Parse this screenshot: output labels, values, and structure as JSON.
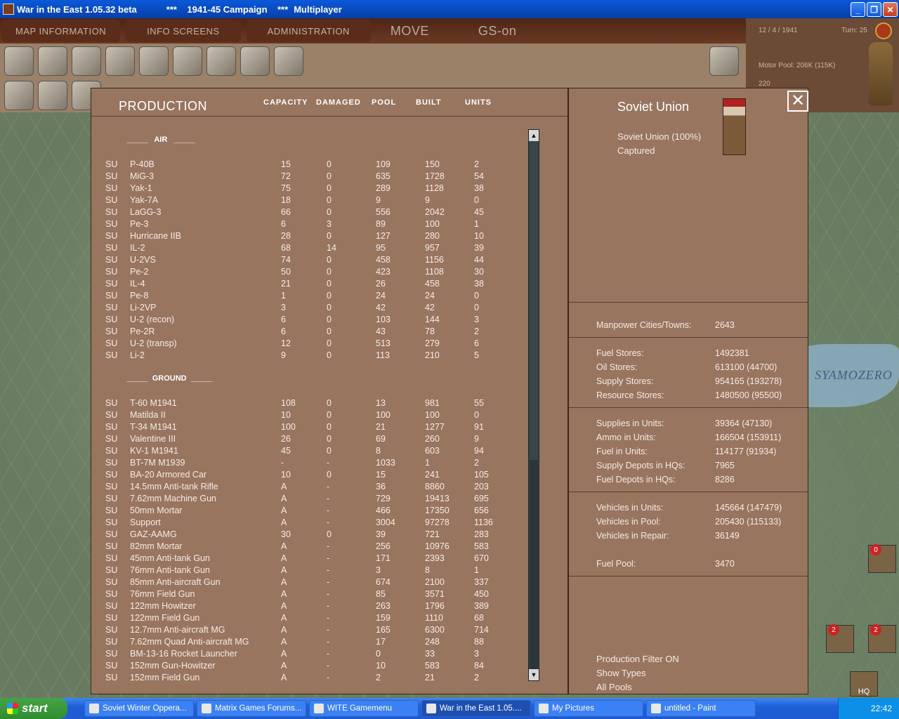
{
  "window": {
    "title": "War in the East 1.05.32 beta",
    "campaign": "***    1941-45 Campaign    ***",
    "mode": "Multiplayer"
  },
  "menu": {
    "items": [
      "MAP INFORMATION",
      "INFO SCREENS",
      "ADMINISTRATION"
    ],
    "phase": "MOVE",
    "gs": "GS-on"
  },
  "status": {
    "date": "12 / 4 / 1941",
    "turn": "Turn: 25",
    "motor_pool": "Motor Pool:  206K (115K)",
    "partial": "220"
  },
  "map": {
    "lake_label": "SYAMOZERO"
  },
  "production": {
    "title": "PRODUCTION",
    "columns": [
      "CAPACITY",
      "DAMAGED",
      "POOL",
      "BUILT",
      "UNITS"
    ],
    "air_header": "_____   AIR   _____",
    "ground_header": "_____  GROUND  _____",
    "air": [
      [
        "SU",
        "P-40B",
        "15",
        "0",
        "109",
        "150",
        "2"
      ],
      [
        "SU",
        "MiG-3",
        "72",
        "0",
        "635",
        "1728",
        "54"
      ],
      [
        "SU",
        "Yak-1",
        "75",
        "0",
        "289",
        "1128",
        "38"
      ],
      [
        "SU",
        "Yak-7A",
        "18",
        "0",
        "9",
        "9",
        "0"
      ],
      [
        "SU",
        "LaGG-3",
        "66",
        "0",
        "556",
        "2042",
        "45"
      ],
      [
        "SU",
        "Pe-3",
        "6",
        "3",
        "89",
        "100",
        "1"
      ],
      [
        "SU",
        "Hurricane IIB",
        "28",
        "0",
        "127",
        "280",
        "10"
      ],
      [
        "SU",
        "IL-2",
        "68",
        "14",
        "95",
        "957",
        "39"
      ],
      [
        "SU",
        "U-2VS",
        "74",
        "0",
        "458",
        "1156",
        "44"
      ],
      [
        "SU",
        "Pe-2",
        "50",
        "0",
        "423",
        "1108",
        "30"
      ],
      [
        "SU",
        "IL-4",
        "21",
        "0",
        "26",
        "458",
        "38"
      ],
      [
        "SU",
        "Pe-8",
        "1",
        "0",
        "24",
        "24",
        "0"
      ],
      [
        "SU",
        "Li-2VP",
        "3",
        "0",
        "42",
        "42",
        "0"
      ],
      [
        "SU",
        "U-2 (recon)",
        "6",
        "0",
        "103",
        "144",
        "3"
      ],
      [
        "SU",
        "Pe-2R",
        "6",
        "0",
        "43",
        "78",
        "2"
      ],
      [
        "SU",
        "U-2 (transp)",
        "12",
        "0",
        "513",
        "279",
        "6"
      ],
      [
        "SU",
        "Li-2",
        "9",
        "0",
        "113",
        "210",
        "5"
      ]
    ],
    "ground": [
      [
        "SU",
        "T-60 M1941",
        "108",
        "0",
        "13",
        "981",
        "55"
      ],
      [
        "SU",
        "Matilda II",
        "10",
        "0",
        "100",
        "100",
        "0"
      ],
      [
        "SU",
        "T-34 M1941",
        "100",
        "0",
        "21",
        "1277",
        "91"
      ],
      [
        "SU",
        "Valentine III",
        "26",
        "0",
        "69",
        "260",
        "9"
      ],
      [
        "SU",
        "KV-1 M1941",
        "45",
        "0",
        "8",
        "603",
        "94"
      ],
      [
        "SU",
        "BT-7M M1939",
        "-",
        "-",
        "1033",
        "1",
        "2"
      ],
      [
        "SU",
        "BA-20 Armored Car",
        "10",
        "0",
        "15",
        "241",
        "105"
      ],
      [
        "SU",
        "14.5mm Anti-tank Rifle",
        "A",
        "-",
        "36",
        "8860",
        "203"
      ],
      [
        "SU",
        "7.62mm Machine Gun",
        "A",
        "-",
        "729",
        "19413",
        "695"
      ],
      [
        "SU",
        "50mm Mortar",
        "A",
        "-",
        "466",
        "17350",
        "656"
      ],
      [
        "SU",
        "Support",
        "A",
        "-",
        "3004",
        "97278",
        "1136"
      ],
      [
        "SU",
        "GAZ-AAMG",
        "30",
        "0",
        "39",
        "721",
        "283"
      ],
      [
        "SU",
        "82mm Mortar",
        "A",
        "-",
        "256",
        "10976",
        "583"
      ],
      [
        "SU",
        "45mm Anti-tank Gun",
        "A",
        "-",
        "171",
        "2393",
        "670"
      ],
      [
        "SU",
        "76mm Anti-tank Gun",
        "A",
        "-",
        "3",
        "8",
        "1"
      ],
      [
        "SU",
        "85mm Anti-aircraft Gun",
        "A",
        "-",
        "674",
        "2100",
        "337"
      ],
      [
        "SU",
        "76mm Field Gun",
        "A",
        "-",
        "85",
        "3571",
        "450"
      ],
      [
        "SU",
        "122mm Howitzer",
        "A",
        "-",
        "263",
        "1796",
        "389"
      ],
      [
        "SU",
        "122mm Field Gun",
        "A",
        "-",
        "159",
        "1110",
        "68"
      ],
      [
        "SU",
        "12.7mm Anti-aircraft MG",
        "A",
        "-",
        "165",
        "6300",
        "714"
      ],
      [
        "SU",
        "7.62mm Quad Anti-aircraft MG",
        "A",
        "-",
        "17",
        "248",
        "88"
      ],
      [
        "SU",
        "BM-13-16 Rocket Launcher",
        "A",
        "-",
        "0",
        "33",
        "3"
      ],
      [
        "SU",
        "152mm Gun-Howitzer",
        "A",
        "-",
        "10",
        "583",
        "84"
      ],
      [
        "SU",
        "152mm Field Gun",
        "A",
        "-",
        "2",
        "21",
        "2"
      ]
    ]
  },
  "side": {
    "nation": "Soviet Union",
    "control": "Soviet Union  (100%)",
    "captured": "Captured",
    "close": "✕",
    "stats": [
      {
        "label": "Manpower Cities/Towns:",
        "value": "2643"
      },
      {
        "label": "Fuel Stores:",
        "value": "1492381"
      },
      {
        "label": "Oil Stores:",
        "value": "613100 (44700)"
      },
      {
        "label": "Supply Stores:",
        "value": "954165 (193278)"
      },
      {
        "label": "Resource Stores:",
        "value": "1480500 (95500)"
      },
      {
        "label": "Supplies in Units:",
        "value": "39364 (47130)"
      },
      {
        "label": "Ammo in Units:",
        "value": "166504 (153911)"
      },
      {
        "label": "Fuel in Units:",
        "value": "114177 (91934)"
      },
      {
        "label": "Supply Depots in HQs:",
        "value": "7965"
      },
      {
        "label": "Fuel Depots in HQs:",
        "value": "8286"
      },
      {
        "label": "Vehicles in Units:",
        "value": "145664 (147479)"
      },
      {
        "label": "Vehicles in Pool:",
        "value": "205430 (115133)"
      },
      {
        "label": "Vehicles in Repair:",
        "value": "36149"
      },
      {
        "label": "Fuel Pool:",
        "value": "3470"
      }
    ],
    "filters": [
      "Production Filter ON",
      "Show Types",
      "All Pools"
    ]
  },
  "counters": {
    "c1": "0",
    "c2": "2",
    "c3": "2",
    "hq": "HQ"
  },
  "taskbar": {
    "start": "start",
    "tasks": [
      "Soviet Winter Oppera...",
      "Matrix Games Forums...",
      "WITE Gamemenu",
      "War in the East 1.05....",
      "My Pictures",
      "untitled - Paint"
    ],
    "clock": "22:42"
  }
}
